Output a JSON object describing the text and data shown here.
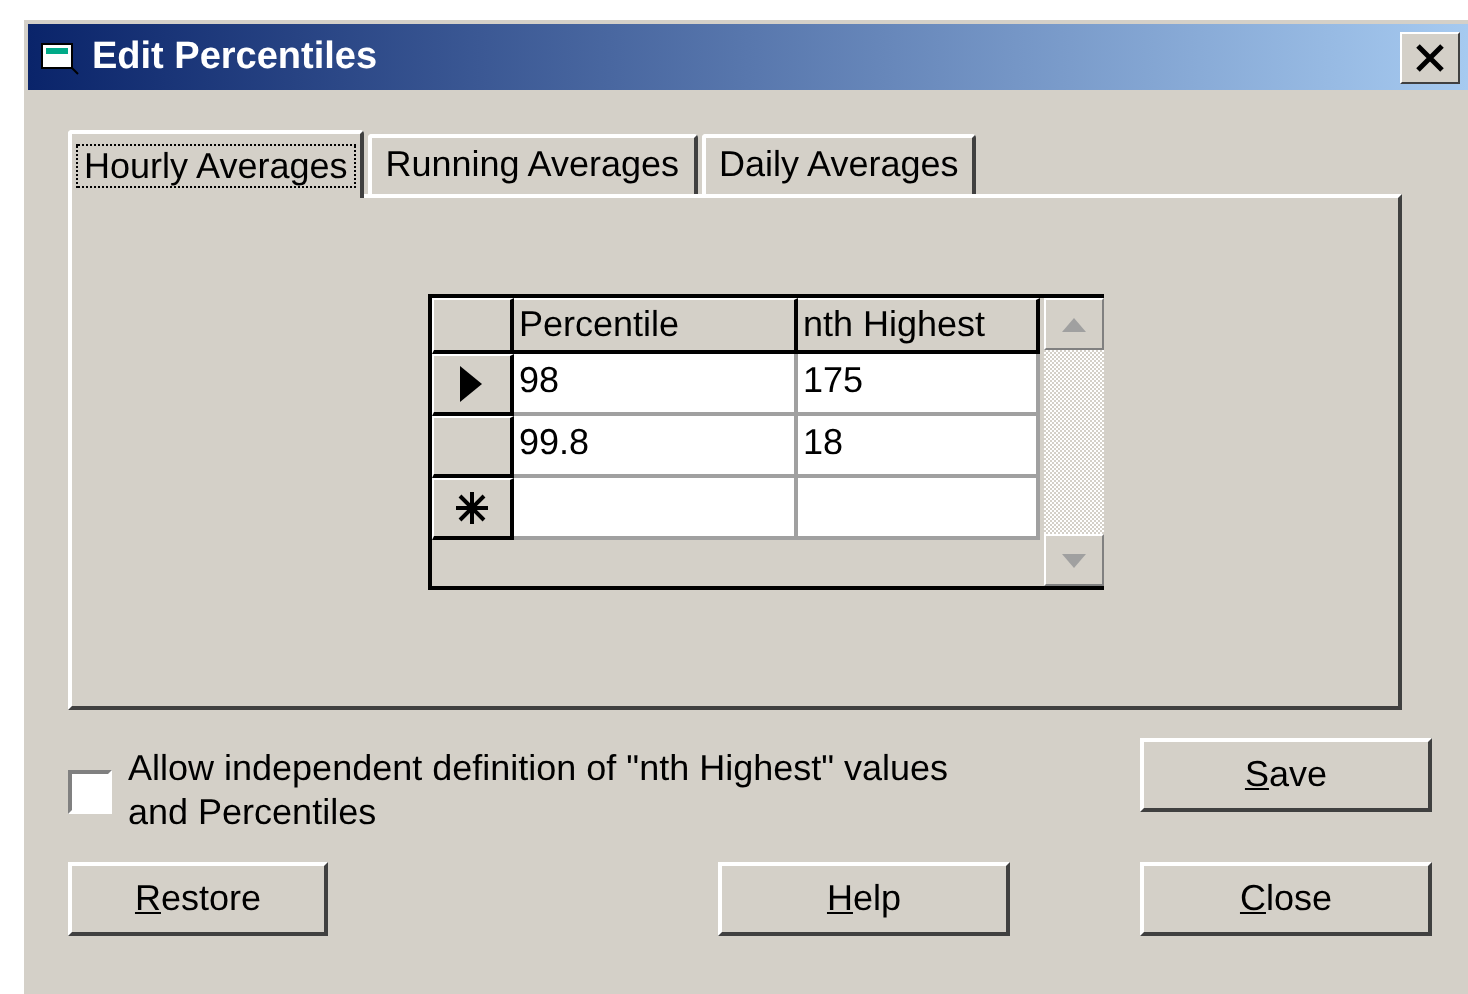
{
  "window": {
    "title": "Edit Percentiles"
  },
  "tabs": [
    {
      "label": "Hourly Averages",
      "selected": true
    },
    {
      "label": "Running Averages",
      "selected": false
    },
    {
      "label": "Daily Averages",
      "selected": false
    }
  ],
  "grid": {
    "columns": [
      "Percentile",
      "nth Highest"
    ],
    "rows": [
      {
        "kind": "current",
        "cells": [
          "98",
          "175"
        ]
      },
      {
        "kind": "plain",
        "cells": [
          "99.8",
          "18"
        ]
      },
      {
        "kind": "new",
        "cells": [
          "",
          ""
        ]
      }
    ]
  },
  "checkbox": {
    "label": "Allow independent definition of \"nth Highest\" values and Percentiles",
    "checked": false
  },
  "buttons": [
    {
      "label": "Save"
    },
    {
      "label": "Restore"
    },
    {
      "label": "Help"
    },
    {
      "label": "Close"
    }
  ]
}
